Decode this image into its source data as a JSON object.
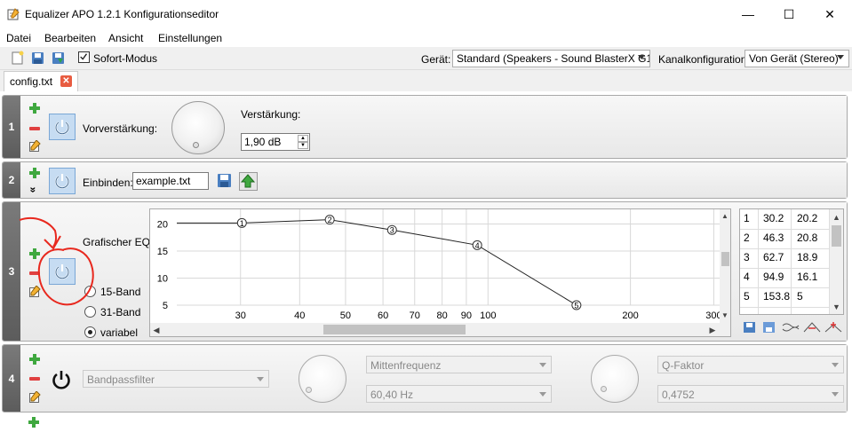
{
  "window": {
    "title": "Equalizer APO 1.2.1 Konfigurationseditor",
    "minimize": "—",
    "maximize": "☐",
    "close": "✕"
  },
  "menu": [
    "Datei",
    "Bearbeiten",
    "Ansicht",
    "Einstellungen"
  ],
  "toolbar": {
    "instant_mode_label": "Sofort-Modus",
    "instant_mode_checked": true,
    "device_label": "Gerät:",
    "device_value": "Standard (Speakers - Sound BlasterX G1)",
    "channel_label": "Kanalkonfiguration:",
    "channel_value": "Von Gerät (Stereo)"
  },
  "tab": {
    "label": "config.txt",
    "close": "✕"
  },
  "rows": {
    "r1": {
      "num": "1",
      "preamp_label": "Vorverstärkung:",
      "gain_label": "Verstärkung:",
      "gain_value": "1,90 dB"
    },
    "r2": {
      "num": "2",
      "include_label": "Einbinden:",
      "include_value": "example.txt",
      "expand": "»"
    },
    "r3": {
      "num": "3",
      "eq_label": "Grafischer EQ:",
      "band15": "15-Band",
      "band31": "31-Band",
      "variable": "variabel"
    },
    "r4": {
      "num": "4",
      "filter_type": "Bandpassfilter",
      "center_label": "Mittenfrequenz",
      "center_value": "60,40 Hz",
      "q_label": "Q-Faktor",
      "q_value": "0,4752"
    }
  },
  "graph": {
    "y_ticks": [
      "20",
      "15",
      "10",
      "5"
    ],
    "x_ticks": [
      "30",
      "40",
      "50",
      "60",
      "70",
      "80",
      "90",
      "100",
      "200",
      "300"
    ],
    "points": [
      {
        "id": "1",
        "f": 30.2,
        "g": 20.2
      },
      {
        "id": "2",
        "f": 46.3,
        "g": 20.8
      },
      {
        "id": "3",
        "f": 62.7,
        "g": 18.9
      },
      {
        "id": "4",
        "f": 94.9,
        "g": 16.1
      },
      {
        "id": "5",
        "f": 153.8,
        "g": 5
      }
    ]
  },
  "table": [
    [
      "1",
      "30.2",
      "20.2"
    ],
    [
      "2",
      "46.3",
      "20.8"
    ],
    [
      "3",
      "62.7",
      "18.9"
    ],
    [
      "4",
      "94.9",
      "16.1"
    ],
    [
      "5",
      "153.8",
      "5"
    ]
  ],
  "colors": {
    "annotation": "#e8281e",
    "power_bg": "#c6dcf2",
    "row_number_bg": "#6a6a6a"
  }
}
